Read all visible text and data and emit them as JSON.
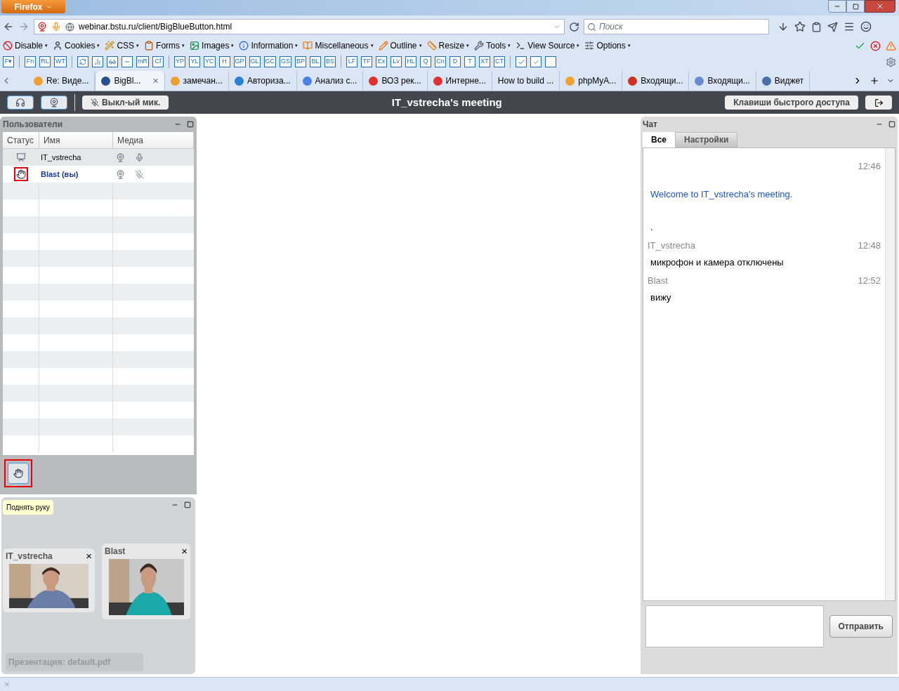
{
  "browser": {
    "app_button": "Firefox",
    "url": "webinar.bstu.ru/client/BigBlueButton.html",
    "search_placeholder": "Поиск",
    "devbar": [
      {
        "label": "Disable",
        "arrow": "▾"
      },
      {
        "label": "Cookies",
        "arrow": "▾"
      },
      {
        "label": "CSS",
        "arrow": "▾"
      },
      {
        "label": "Forms",
        "arrow": "▾"
      },
      {
        "label": "Images",
        "arrow": "▾"
      },
      {
        "label": "Information",
        "arrow": "▾"
      },
      {
        "label": "Miscellaneous",
        "arrow": "▾"
      },
      {
        "label": "Outline",
        "arrow": "▾"
      },
      {
        "label": "Resize",
        "arrow": "▾"
      },
      {
        "label": "Tools",
        "arrow": "▾"
      },
      {
        "label": "View Source",
        "arrow": "▾"
      },
      {
        "label": "Options",
        "arrow": "▾"
      }
    ],
    "tool_buttons": [
      {
        "kind": "label",
        "label": "F▾"
      },
      {
        "kind": "sep"
      },
      {
        "kind": "label",
        "label": "Fn"
      },
      {
        "kind": "label",
        "label": "RL"
      },
      {
        "kind": "label",
        "label": "WT"
      },
      {
        "kind": "sep"
      },
      {
        "kind": "sync"
      },
      {
        "kind": "chart"
      },
      {
        "kind": "glasses"
      },
      {
        "kind": "bar"
      },
      {
        "kind": "label",
        "label": "mR"
      },
      {
        "kind": "label",
        "label": "Cf"
      },
      {
        "kind": "sep"
      },
      {
        "kind": "label",
        "label": "YP"
      },
      {
        "kind": "label",
        "label": "YL"
      },
      {
        "kind": "label",
        "label": "YC"
      },
      {
        "kind": "label",
        "label": "H"
      },
      {
        "kind": "label",
        "label": "GP"
      },
      {
        "kind": "label",
        "label": "GL"
      },
      {
        "kind": "label",
        "label": "GC"
      },
      {
        "kind": "label",
        "label": "GS"
      },
      {
        "kind": "label",
        "label": "BP"
      },
      {
        "kind": "label",
        "label": "BL"
      },
      {
        "kind": "label",
        "label": "BS"
      },
      {
        "kind": "sep"
      },
      {
        "kind": "label",
        "label": "LF"
      },
      {
        "kind": "label",
        "label": "TF"
      },
      {
        "kind": "label",
        "label": "Ex"
      },
      {
        "kind": "label",
        "label": "Lv"
      },
      {
        "kind": "label",
        "label": "HL"
      },
      {
        "kind": "label",
        "label": "Q"
      },
      {
        "kind": "label",
        "label": "Cn"
      },
      {
        "kind": "label",
        "label": "D"
      },
      {
        "kind": "label",
        "label": "T"
      },
      {
        "kind": "label",
        "label": "XT"
      },
      {
        "kind": "label",
        "label": "CT"
      },
      {
        "kind": "sep"
      },
      {
        "kind": "check"
      },
      {
        "kind": "check2"
      },
      {
        "kind": "blank"
      }
    ],
    "tabs": [
      {
        "label": "Re: Виде...",
        "selected": false,
        "color": "#f0a030"
      },
      {
        "label": "BigBl...",
        "selected": true,
        "color": "#2a4f8f",
        "close": "×"
      },
      {
        "label": "замечан...",
        "selected": false,
        "color": "#f0a030"
      },
      {
        "label": "Авториза...",
        "selected": false,
        "color": "#2a7fd0"
      },
      {
        "label": "Анализ с...",
        "selected": false,
        "color": "#4a80e8"
      },
      {
        "label": "ВОЗ рек...",
        "selected": false,
        "color": "#e03030"
      },
      {
        "label": "Интерне...",
        "selected": false,
        "color": "#e03030"
      },
      {
        "label": "How to build ...",
        "selected": false
      },
      {
        "label": "phpMyA...",
        "selected": false,
        "color": "#f0a030"
      },
      {
        "label": "Входящи...",
        "selected": false,
        "color": "#d03020"
      },
      {
        "label": "Входящи...",
        "selected": false,
        "color": "#6a8ad0"
      },
      {
        "label": "Виджет",
        "selected": false,
        "color": "#4a6fa5"
      }
    ]
  },
  "meeting": {
    "mic_button": "Выкл-ый мик.",
    "title": "IT_vstrecha's meeting",
    "shortcuts_button": "Клавиши быстрого доступа"
  },
  "users": {
    "title": "Пользователи",
    "columns": [
      "Статус",
      "Имя",
      "Медиа"
    ],
    "rows": [
      {
        "kind": "presenter",
        "name": "IT_vstrecha",
        "self": false,
        "mic_muted": false
      },
      {
        "kind": "hand",
        "name": "Blast (вы)",
        "self": true,
        "mic_muted": true
      }
    ],
    "raise_hand_tooltip": "Поднять руку"
  },
  "webcams": [
    {
      "name": "IT_vstrecha",
      "close": "×"
    },
    {
      "name": "Blast",
      "close": "×"
    }
  ],
  "presentation": "Презентация: default.pdf",
  "chat": {
    "title": "Чат",
    "tabs": [
      {
        "label": "Все",
        "selected": true
      },
      {
        "label": "Настройки",
        "selected": false
      }
    ],
    "messages": [
      {
        "kind": "system",
        "time": "12:46",
        "text": "Welcome to IT_vstrecha's meeting.",
        "extra": "."
      },
      {
        "kind": "user",
        "sender": "IT_vstrecha",
        "time": "12:48",
        "text": "микрофон и камера отключены"
      },
      {
        "kind": "user",
        "sender": "Blast",
        "time": "12:52",
        "text": "вижу"
      }
    ],
    "send_button": "Отправить"
  },
  "status_bar": {
    "close": "×"
  }
}
